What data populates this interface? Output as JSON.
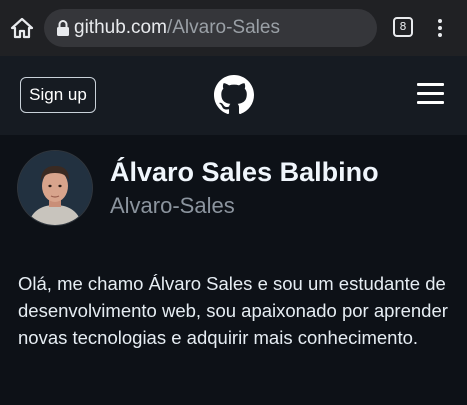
{
  "browser": {
    "url_host": "github.com",
    "url_path": "/Alvaro-Sales",
    "tab_count": "8",
    "icons": [
      "home-icon",
      "lock-icon",
      "tabs-icon",
      "more-vert-icon"
    ]
  },
  "header": {
    "signup_label": "Sign up",
    "icons": [
      "github-logo-icon",
      "hamburger-menu-icon"
    ]
  },
  "profile": {
    "name": "Álvaro Sales Balbino",
    "login": "Alvaro-Sales",
    "bio": "Olá, me chamo Álvaro Sales e sou um estudante de desenvolvimento web, sou apaixonado por aprender novas tecnologias e adquirir mais conhecimento."
  },
  "colors": {
    "page_bg": "#0d1117",
    "header_bg": "#161b22",
    "chrome_bg": "#202124",
    "muted_text": "#8b949e"
  }
}
